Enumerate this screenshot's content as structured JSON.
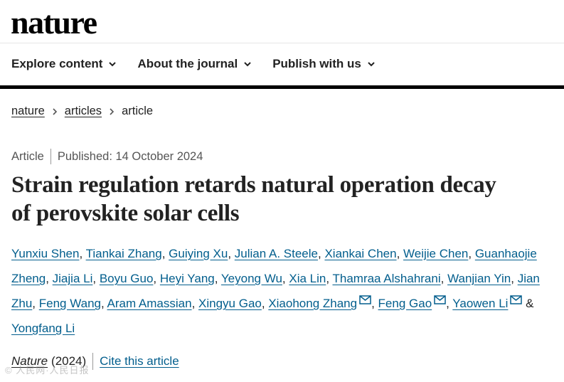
{
  "header": {
    "logo": "nature",
    "nav": [
      {
        "label": "Explore content"
      },
      {
        "label": "About the journal"
      },
      {
        "label": "Publish with us"
      }
    ]
  },
  "breadcrumb": {
    "items": [
      "nature",
      "articles"
    ],
    "current": "article"
  },
  "article": {
    "type": "Article",
    "published": "Published: 14 October 2024",
    "title": "Strain regulation retards natural operation decay of perovskite solar cells",
    "authors": [
      "Yunxiu Shen",
      "Tiankai Zhang",
      "Guiying Xu",
      "Julian A. Steele",
      "Xiankai Chen",
      "Weijie Chen",
      "Guanhaojie Zheng",
      "Jiajia Li",
      "Boyu Guo",
      "Heyi Yang",
      "Yeyong Wu",
      "Xia Lin",
      "Thamraa Alshahrani",
      "Wanjian Yin",
      "Jian Zhu",
      "Feng Wang",
      "Aram Amassian",
      "Xingyu Gao",
      "Xiaohong Zhang",
      "Feng Gao",
      "Yaowen Li",
      "Yongfang Li"
    ],
    "ampersand": "&",
    "citation": {
      "journal": "Nature",
      "year": "(2024)",
      "cite_label": "Cite this article"
    }
  },
  "colors": {
    "link": "#025e8d",
    "text": "#222222",
    "nav_bar": "#000000"
  },
  "watermark": "© 人民网·人民日报"
}
